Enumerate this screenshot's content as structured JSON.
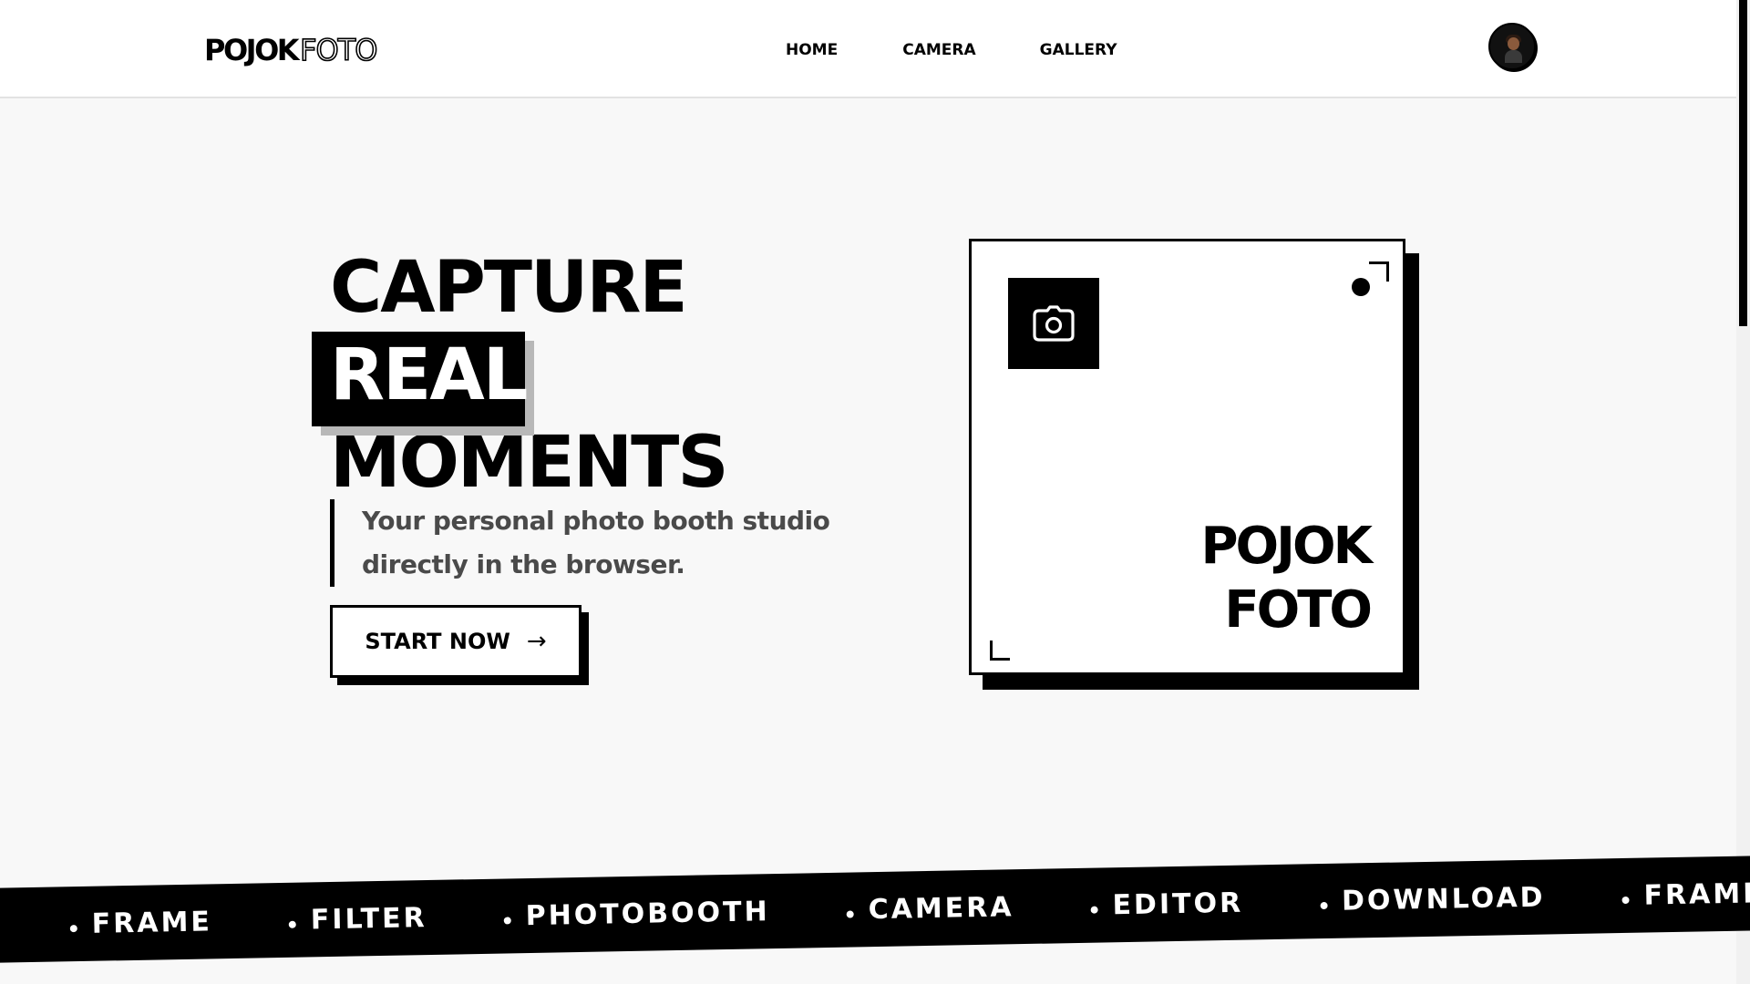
{
  "nav": {
    "logo_solid": "POJOK",
    "logo_outline": "FOTO",
    "links": [
      "HOME",
      "CAMERA",
      "GALLERY"
    ]
  },
  "hero": {
    "title_line1": "CAPTURE",
    "title_line2": "REAL",
    "title_line3": "MOMENTS",
    "subtitle": "Your personal photo booth studio directly in the browser.",
    "cta_label": "START NOW",
    "cta_arrow": "→"
  },
  "card": {
    "brand_line1": "POJOK",
    "brand_line2": "FOTO",
    "icon": "camera-icon"
  },
  "marquee": {
    "items": [
      "FRAME",
      "FILTER",
      "PHOTOBOOTH",
      "CAMERA",
      "EDITOR",
      "DOWNLOAD",
      "FRAME"
    ]
  },
  "colors": {
    "background": "#f8f8f8",
    "primary": "#000000",
    "surface": "#ffffff",
    "muted_text": "#4a4a4a",
    "accent_shadow": "#b8b8b8"
  }
}
